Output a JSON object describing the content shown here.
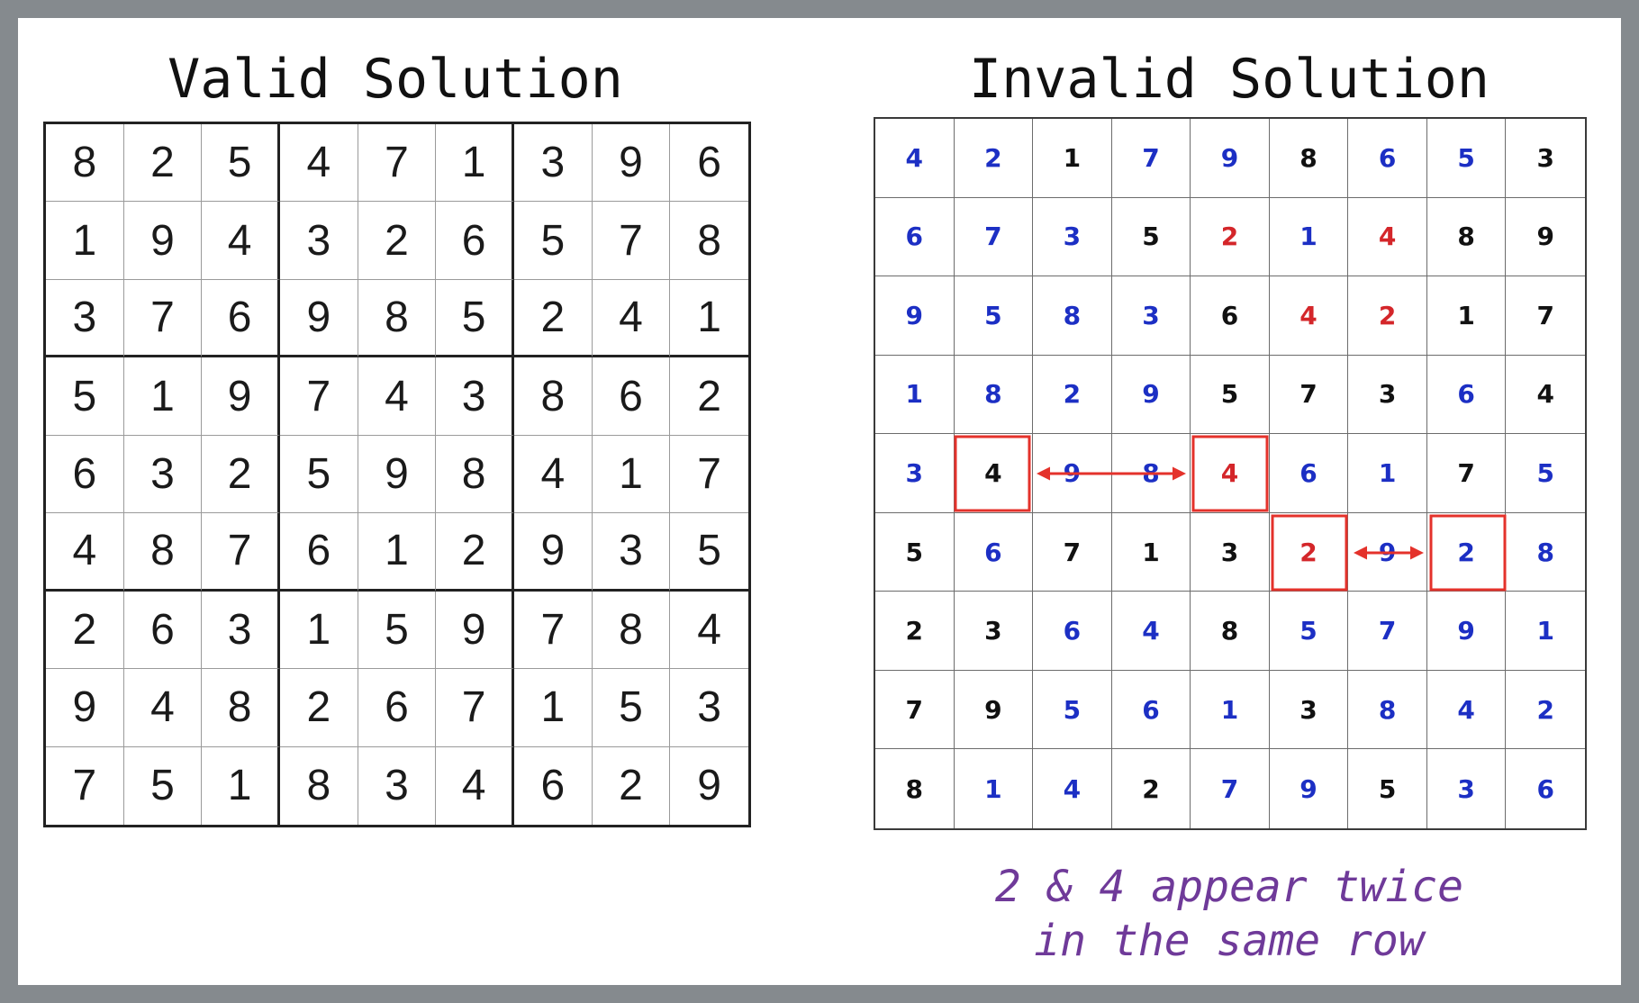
{
  "left_panel": {
    "title": "Valid Solution",
    "grid": [
      [
        8,
        2,
        5,
        4,
        7,
        1,
        3,
        9,
        6
      ],
      [
        1,
        9,
        4,
        3,
        2,
        6,
        5,
        7,
        8
      ],
      [
        3,
        7,
        6,
        9,
        8,
        5,
        2,
        4,
        1
      ],
      [
        5,
        1,
        9,
        7,
        4,
        3,
        8,
        6,
        2
      ],
      [
        6,
        3,
        2,
        5,
        9,
        8,
        4,
        1,
        7
      ],
      [
        4,
        8,
        7,
        6,
        1,
        2,
        9,
        3,
        5
      ],
      [
        2,
        6,
        3,
        1,
        5,
        9,
        7,
        8,
        4
      ],
      [
        9,
        4,
        8,
        2,
        6,
        7,
        1,
        5,
        3
      ],
      [
        7,
        5,
        1,
        8,
        3,
        4,
        6,
        2,
        9
      ]
    ]
  },
  "right_panel": {
    "title": "Invalid Solution",
    "grid": [
      [
        4,
        2,
        1,
        7,
        9,
        8,
        6,
        5,
        3
      ],
      [
        6,
        7,
        3,
        5,
        2,
        1,
        4,
        8,
        9
      ],
      [
        9,
        5,
        8,
        3,
        6,
        4,
        2,
        1,
        7
      ],
      [
        1,
        8,
        2,
        9,
        5,
        7,
        3,
        6,
        4
      ],
      [
        3,
        4,
        9,
        8,
        4,
        6,
        1,
        7,
        5
      ],
      [
        5,
        6,
        7,
        1,
        3,
        2,
        9,
        2,
        8
      ],
      [
        2,
        3,
        6,
        4,
        8,
        5,
        7,
        9,
        1
      ],
      [
        7,
        9,
        5,
        6,
        1,
        3,
        8,
        4,
        2
      ],
      [
        8,
        1,
        4,
        2,
        7,
        9,
        5,
        3,
        6
      ]
    ],
    "digit_colors": [
      [
        "b",
        "b",
        "k",
        "b",
        "b",
        "k",
        "b",
        "b",
        "k"
      ],
      [
        "b",
        "b",
        "b",
        "k",
        "r",
        "b",
        "r",
        "k",
        "k"
      ],
      [
        "b",
        "b",
        "b",
        "b",
        "k",
        "r",
        "r",
        "k",
        "k"
      ],
      [
        "b",
        "b",
        "b",
        "b",
        "k",
        "k",
        "k",
        "b",
        "k"
      ],
      [
        "b",
        "k",
        "b",
        "b",
        "r",
        "b",
        "b",
        "k",
        "b"
      ],
      [
        "k",
        "b",
        "k",
        "k",
        "k",
        "r",
        "b",
        "b",
        "b"
      ],
      [
        "k",
        "k",
        "b",
        "b",
        "k",
        "b",
        "b",
        "b",
        "b"
      ],
      [
        "k",
        "k",
        "b",
        "b",
        "b",
        "k",
        "b",
        "b",
        "b"
      ],
      [
        "k",
        "b",
        "b",
        "k",
        "b",
        "b",
        "k",
        "b",
        "b"
      ]
    ],
    "color_key": {
      "k": "#111111",
      "b": "#1c2fc4",
      "r": "#d4262a"
    },
    "highlight_color": "#e4322b",
    "highlighted_cells": [
      [
        4,
        1
      ],
      [
        4,
        4
      ],
      [
        5,
        5
      ],
      [
        5,
        7
      ]
    ],
    "arrows": [
      {
        "row": 4,
        "from_col": 1,
        "to_col": 4
      },
      {
        "row": 5,
        "from_col": 5,
        "to_col": 7
      }
    ],
    "caption_lines": [
      "2 & 4 appear twice",
      "in the same row"
    ]
  },
  "colors": {
    "frame": "#858a8e",
    "caption": "#6f3a99"
  }
}
